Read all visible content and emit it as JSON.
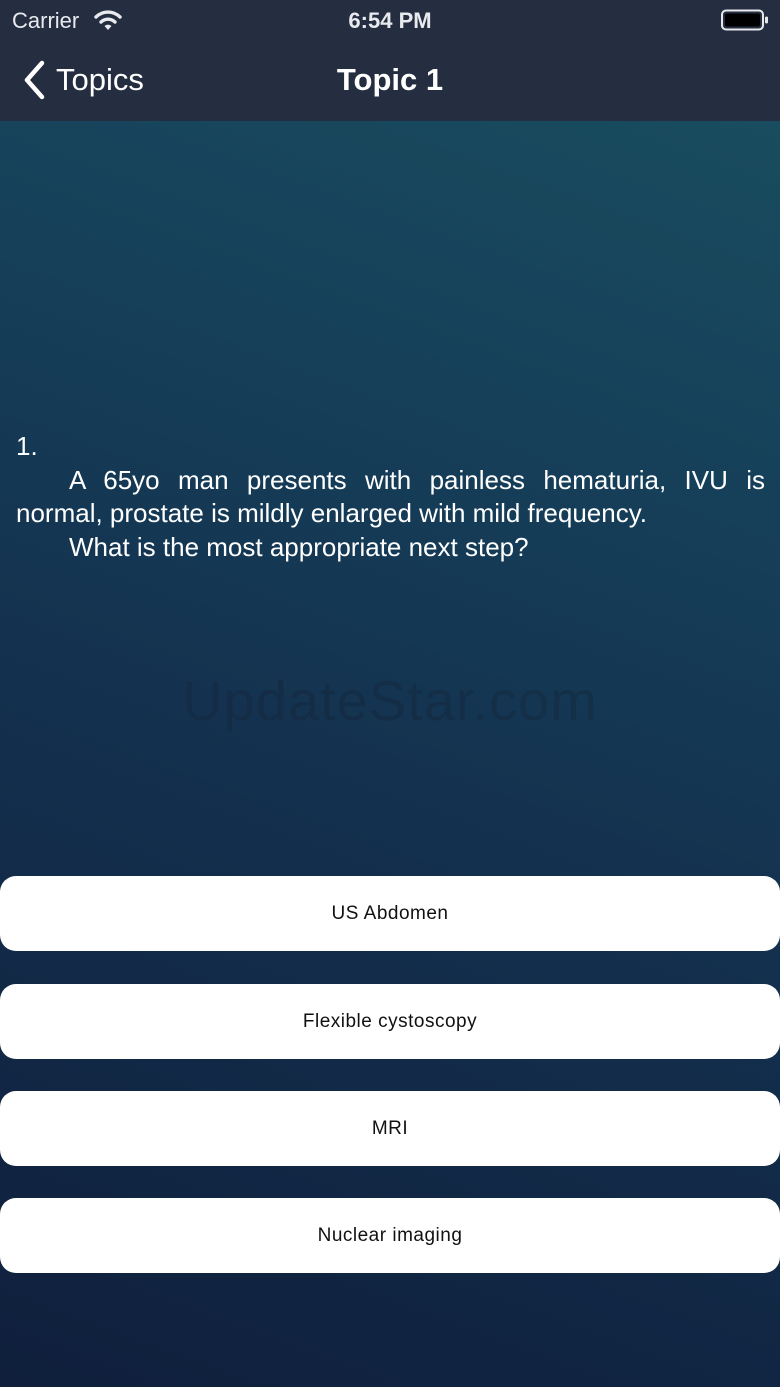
{
  "status_bar": {
    "carrier": "Carrier",
    "time": "6:54 PM"
  },
  "nav": {
    "back_label": "Topics",
    "title": "Topic 1"
  },
  "question": {
    "number": "1.",
    "body": "A 65yo man presents with painless hematuria, IVU is normal, prostate is mildly enlarged with mild frequency.",
    "ask": "What is the most appropriate next step?"
  },
  "watermark": "UpdateStar.com",
  "answers": [
    {
      "label": "US Abdomen"
    },
    {
      "label": "Flexible cystoscopy"
    },
    {
      "label": "MRI"
    },
    {
      "label": "Nuclear imaging"
    }
  ],
  "colors": {
    "nav_background": "#242e40",
    "gradient_top": "#1a5060",
    "gradient_bottom": "#0f1f3c",
    "button_background": "#ffffff",
    "text_light": "#ffffff"
  }
}
